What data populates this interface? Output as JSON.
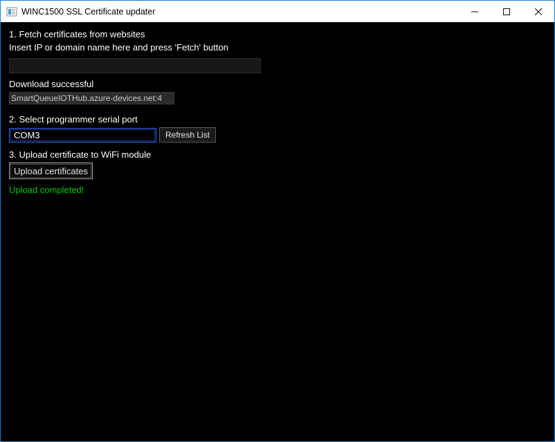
{
  "window": {
    "title": "WINC1500 SSL Certificate updater"
  },
  "step1": {
    "heading": "1. Fetch certificates from websites",
    "hint": "Insert IP or domain name here and press 'Fetch' button",
    "input_value": "",
    "status": "Download successful",
    "list_item": "SmartQueueIOTHub.azure-devices.net:4"
  },
  "step2": {
    "heading": "2. Select programmer serial port",
    "port_value": "COM3",
    "refresh_label": "Refresh List"
  },
  "step3": {
    "heading": "3. Upload certificate to WiFi module",
    "upload_label": "Upload certificates",
    "result": "Upload completed!"
  }
}
